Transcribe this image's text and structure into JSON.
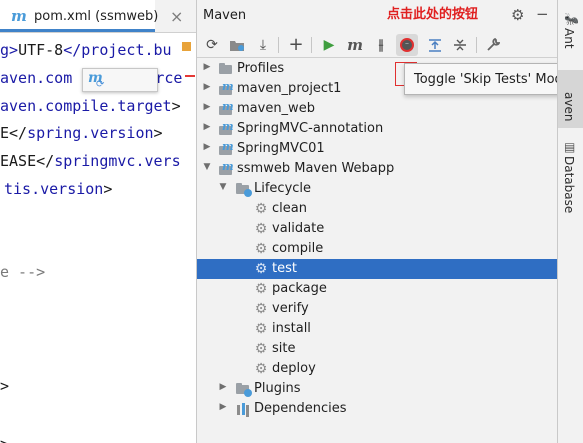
{
  "annotation": "点击此处的按钮",
  "editor": {
    "tab_title": "pom.xml (ssmweb)",
    "tab_icon": "m",
    "lines": [
      {
        "prefix": "g>",
        "text": "UTF-8",
        "suffix": "</project.bu"
      },
      {
        "prefix": "aven.com",
        "text": "",
        "suffix": "source"
      },
      {
        "prefix": "aven.compile.target",
        "text": "",
        "suffix": ">"
      },
      {
        "prefix": "E</",
        "text": "spring.version",
        "suffix": ">"
      },
      {
        "prefix": "EASE</",
        "text": "springmvc.vers",
        "suffix": ""
      },
      {
        "prefix": "tis.version",
        "text": "",
        "suffix": ">"
      },
      {
        "prefix": "e -->",
        "text": "",
        "suffix": ""
      },
      {
        "prefix": ">",
        "text": "",
        "suffix": ""
      },
      {
        "prefix": ">",
        "text": "",
        "suffix": ""
      }
    ]
  },
  "maven": {
    "title": "Maven",
    "toolbar": [
      {
        "name": "reload-icon",
        "glyph": "⟳"
      },
      {
        "name": "generate-sources-icon",
        "glyph": "📁"
      },
      {
        "name": "download-icon",
        "glyph": "⤓"
      },
      {
        "name": "add-icon",
        "glyph": "+"
      },
      {
        "name": "run-icon",
        "glyph": "▶"
      },
      {
        "name": "execute-goal-icon",
        "glyph": "m"
      },
      {
        "name": "toggle-offline-icon",
        "glyph": "⊣⊢"
      },
      {
        "name": "skip-tests-icon",
        "glyph": "⁻"
      },
      {
        "name": "show-dependencies-icon",
        "glyph": "⇅"
      },
      {
        "name": "collapse-all-icon",
        "glyph": "≑"
      },
      {
        "name": "settings-wrench-icon",
        "glyph": "🔧"
      }
    ],
    "tree": [
      {
        "label": "Profiles",
        "level": 0,
        "arrow": "▶",
        "icon": "folder"
      },
      {
        "label": "maven_project1",
        "level": 0,
        "arrow": "▶",
        "icon": "project"
      },
      {
        "label": "maven_web",
        "level": 0,
        "arrow": "▶",
        "icon": "project"
      },
      {
        "label": "SpringMVC-annotation",
        "level": 0,
        "arrow": "▶",
        "icon": "project"
      },
      {
        "label": "SpringMVC01",
        "level": 0,
        "arrow": "▶",
        "icon": "project"
      },
      {
        "label": "ssmweb Maven Webapp",
        "level": 0,
        "arrow": "▼",
        "icon": "project"
      },
      {
        "label": "Lifecycle",
        "level": 1,
        "arrow": "▼",
        "icon": "folder-gear"
      },
      {
        "label": "clean",
        "level": 2,
        "arrow": "",
        "icon": "gear"
      },
      {
        "label": "validate",
        "level": 2,
        "arrow": "",
        "icon": "gear"
      },
      {
        "label": "compile",
        "level": 2,
        "arrow": "",
        "icon": "gear"
      },
      {
        "label": "test",
        "level": 2,
        "arrow": "",
        "icon": "gear",
        "selected": true
      },
      {
        "label": "package",
        "level": 2,
        "arrow": "",
        "icon": "gear"
      },
      {
        "label": "verify",
        "level": 2,
        "arrow": "",
        "icon": "gear"
      },
      {
        "label": "install",
        "level": 2,
        "arrow": "",
        "icon": "gear"
      },
      {
        "label": "site",
        "level": 2,
        "arrow": "",
        "icon": "gear"
      },
      {
        "label": "deploy",
        "level": 2,
        "arrow": "",
        "icon": "gear"
      },
      {
        "label": "Plugins",
        "level": 1,
        "arrow": "▶",
        "icon": "folder-gear"
      },
      {
        "label": "Dependencies",
        "level": 1,
        "arrow": "▶",
        "icon": "deps"
      }
    ],
    "tooltip": "Toggle 'Skip Tests' Mode"
  },
  "right_stripe": {
    "items": [
      {
        "label": "Ant",
        "active": false
      },
      {
        "label": "aven",
        "active": true
      },
      {
        "label": "Database",
        "active": false
      }
    ]
  },
  "colors": {
    "selection": "#2f6ec3",
    "annotation": "#e02020",
    "accent": "#4083c9"
  }
}
